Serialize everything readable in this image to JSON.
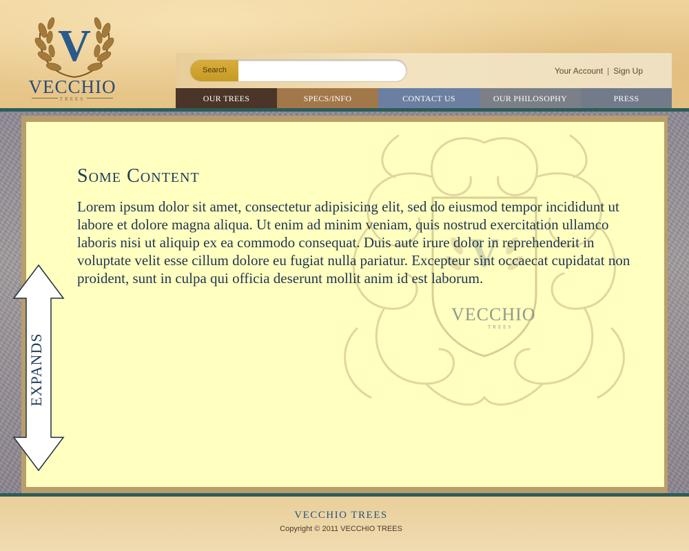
{
  "logo": {
    "letter": "V",
    "name": "VECCHIO",
    "sub": "TREES"
  },
  "search": {
    "button_label": "Search",
    "placeholder": ""
  },
  "account": {
    "your_account": "Your Account",
    "separator": "|",
    "sign_up": "Sign Up"
  },
  "nav": {
    "items": [
      {
        "label": "OUR TREES",
        "color": "#4a3528"
      },
      {
        "label": "SPECS/INFO",
        "color": "#a2774a"
      },
      {
        "label": "CONTACT US",
        "color": "#6b7fa0"
      },
      {
        "label": "OUR PHILOSOPHY",
        "color": "#7b7f87"
      },
      {
        "label": "PRESS",
        "color": "#727b8a"
      }
    ]
  },
  "content": {
    "title": "Some Content",
    "body": "Lorem ipsum dolor sit amet, consectetur adipisicing elit, sed do eiusmod tempor incididunt ut labore et dolore magna aliqua. Ut enim ad minim veniam, quis nostrud exercitation ullamco laboris nisi ut aliquip ex ea commodo consequat. Duis aute irure dolor in reprehenderit in voluptate velit esse cillum dolore eu fugiat nulla pariatur. Excepteur sint occaecat cupidatat non proident, sunt in culpa qui officia deserunt mollit anim id est laborum."
  },
  "watermark": {
    "name": "VECCHIO",
    "sub": "TREES"
  },
  "annotation": {
    "label": "EXPANDS"
  },
  "footer": {
    "name": "VECCHIO TREES",
    "copyright": "Copyright © 2011 VECCHIO TREES"
  },
  "colors": {
    "brand_blue": "#27517a",
    "content_bg": "#ffffc0",
    "accent_rule": "#2e5c5a",
    "search_gold": "#d7ad3c"
  }
}
